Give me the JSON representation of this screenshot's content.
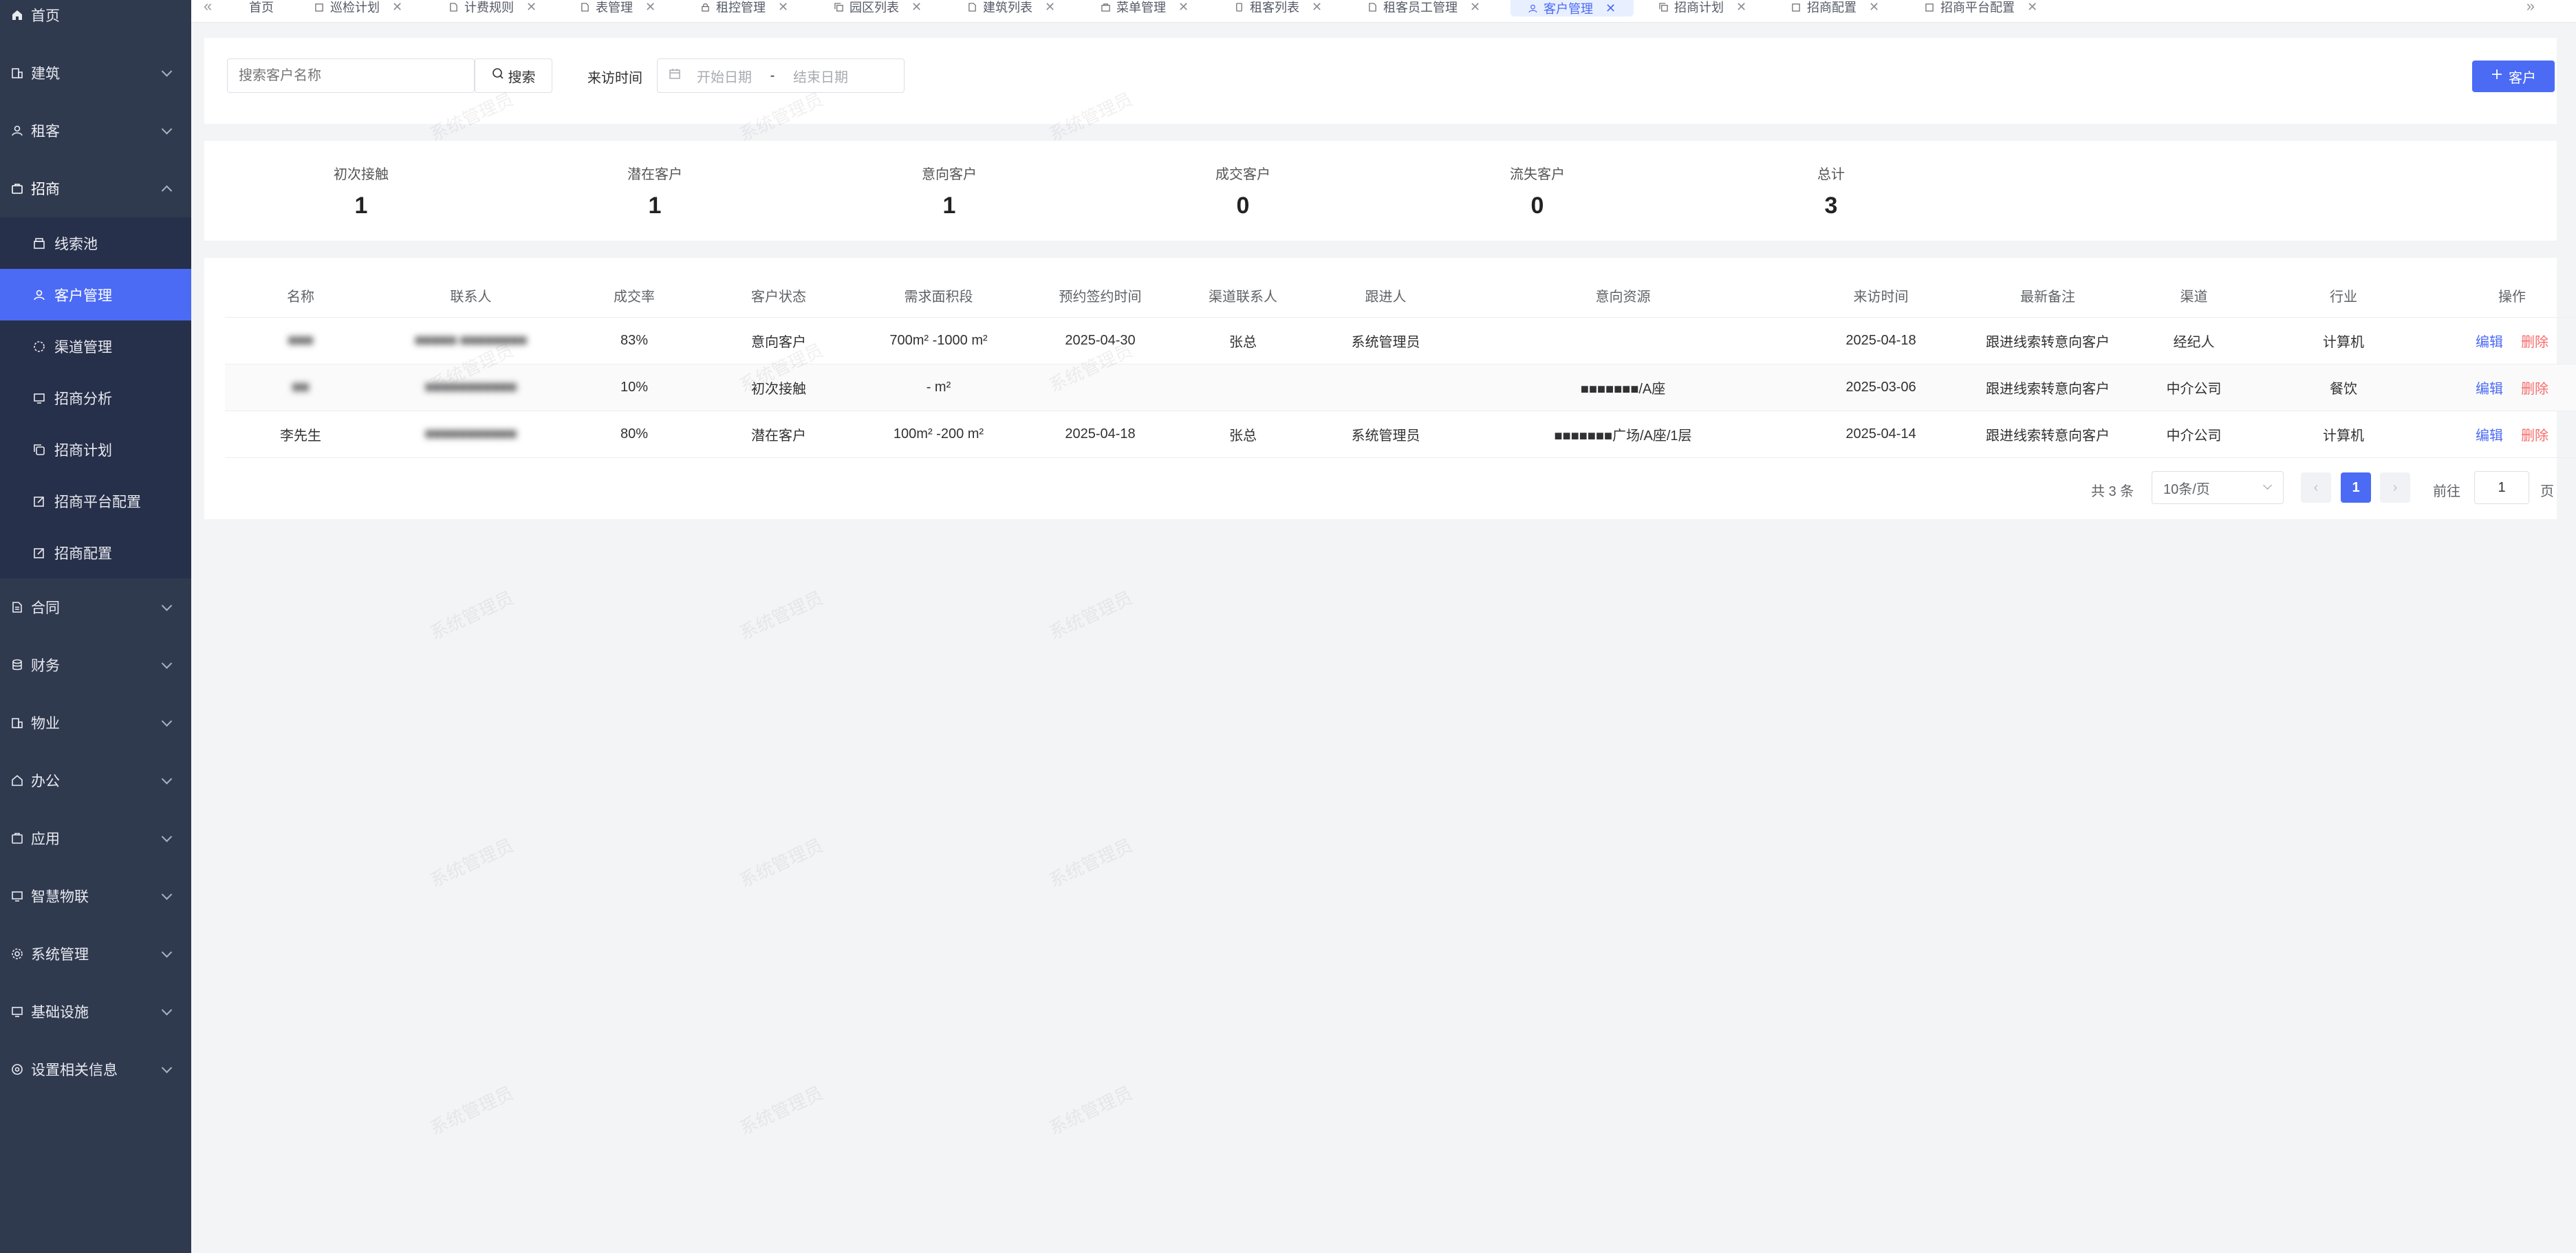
{
  "sidebar": {
    "items": [
      {
        "label": "首页",
        "icon": "home-icon"
      },
      {
        "label": "建筑",
        "icon": "building-icon"
      },
      {
        "label": "租客",
        "icon": "user-icon"
      },
      {
        "label": "招商",
        "icon": "briefcase-icon"
      },
      {
        "label": "合同",
        "icon": "document-icon"
      },
      {
        "label": "财务",
        "icon": "database-icon"
      },
      {
        "label": "物业",
        "icon": "building-icon"
      },
      {
        "label": "办公",
        "icon": "house-icon"
      },
      {
        "label": "应用",
        "icon": "app-icon"
      },
      {
        "label": "智慧物联",
        "icon": "monitor-icon"
      },
      {
        "label": "系统管理",
        "icon": "gear-icon"
      },
      {
        "label": "基础设施",
        "icon": "monitor-icon"
      },
      {
        "label": "设置相关信息",
        "icon": "settings-icon"
      }
    ],
    "subitems": [
      {
        "label": "线索池",
        "icon": "box-icon"
      },
      {
        "label": "客户管理",
        "icon": "user-icon"
      },
      {
        "label": "渠道管理",
        "icon": "circle-icon"
      },
      {
        "label": "招商分析",
        "icon": "monitor-icon"
      },
      {
        "label": "招商计划",
        "icon": "copy-icon"
      },
      {
        "label": "招商平台配置",
        "icon": "edit-icon"
      },
      {
        "label": "招商配置",
        "icon": "edit-icon"
      }
    ]
  },
  "tabs": [
    {
      "label": "首页"
    },
    {
      "label": "巡检计划"
    },
    {
      "label": "计费规则"
    },
    {
      "label": "表管理"
    },
    {
      "label": "租控管理"
    },
    {
      "label": "园区列表"
    },
    {
      "label": "建筑列表"
    },
    {
      "label": "菜单管理"
    },
    {
      "label": "租客列表"
    },
    {
      "label": "租客员工管理"
    },
    {
      "label": "客户管理"
    },
    {
      "label": "招商计划"
    },
    {
      "label": "招商配置"
    },
    {
      "label": "招商平台配置"
    }
  ],
  "filter": {
    "search_placeholder": "搜索客户名称",
    "search_button": "搜索",
    "visit_time_label": "来访时间",
    "start_placeholder": "开始日期",
    "range_sep": "-",
    "end_placeholder": "结束日期",
    "add_button": "客户"
  },
  "stats": [
    {
      "label": "初次接触",
      "value": "1"
    },
    {
      "label": "潜在客户",
      "value": "1"
    },
    {
      "label": "意向客户",
      "value": "1"
    },
    {
      "label": "成交客户",
      "value": "0"
    },
    {
      "label": "流失客户",
      "value": "0"
    },
    {
      "label": "总计",
      "value": "3"
    }
  ],
  "table": {
    "headers": [
      "名称",
      "联系人",
      "成交率",
      "客户状态",
      "需求面积段",
      "预约签约时间",
      "渠道联系人",
      "跟进人",
      "意向资源",
      "来访时间",
      "最新备注",
      "渠道",
      "行业",
      "操作"
    ],
    "rows": [
      {
        "name": "■■■",
        "contact": "■■■■■ ■■■■■■■■",
        "rate": "83%",
        "status": "意向客户",
        "area": "700m² -1000 m²",
        "sign_time": "2025-04-30",
        "channel_contact": "张总",
        "follower": "系统管理员",
        "resource": "",
        "visit_time": "2025-04-18",
        "note": "跟进线索转意向客户",
        "channel": "经纪人",
        "industry": "计算机"
      },
      {
        "name": "■■",
        "contact": "■■■■■■■■■■■",
        "rate": "10%",
        "status": "初次接触",
        "area": "- m²",
        "sign_time": "",
        "channel_contact": "",
        "follower": "",
        "resource": "■■■■■■■/A座",
        "visit_time": "2025-03-06",
        "note": "跟进线索转意向客户",
        "channel": "中介公司",
        "industry": "餐饮"
      },
      {
        "name": "李先生",
        "contact": "■■■■■■■■■■■",
        "rate": "80%",
        "status": "潜在客户",
        "area": "100m² -200 m²",
        "sign_time": "2025-04-18",
        "channel_contact": "张总",
        "follower": "系统管理员",
        "resource": "■■■■■■■广场/A座/1层",
        "visit_time": "2025-04-14",
        "note": "跟进线索转意向客户",
        "channel": "中介公司",
        "industry": "计算机"
      }
    ],
    "edit_label": "编辑",
    "delete_label": "删除"
  },
  "pagination": {
    "total_text": "共 3 条",
    "page_size": "10条/页",
    "current_page": "1",
    "goto_label": "前往",
    "goto_value": "1",
    "page_suffix": "页"
  },
  "watermark_text": "系统管理员",
  "colors": {
    "sidebar": "#303a4f",
    "primary": "#4b6bf5",
    "danger": "#f56c6c"
  }
}
